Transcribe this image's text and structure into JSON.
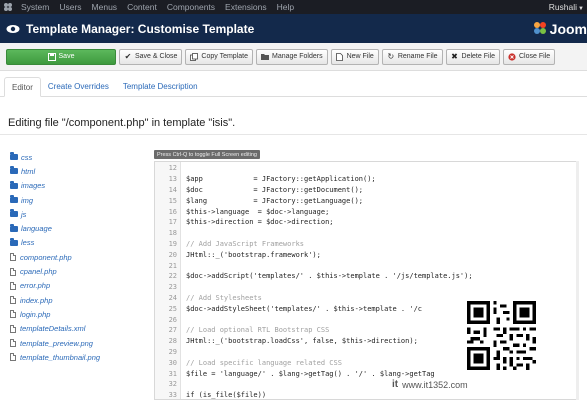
{
  "menubar": {
    "items": [
      "System",
      "Users",
      "Menus",
      "Content",
      "Components",
      "Extensions",
      "Help"
    ],
    "user": "Rushali"
  },
  "titlebar": {
    "title": "Template Manager: Customise Template",
    "brand": "Joom"
  },
  "toolbar": {
    "save": "Save",
    "save_close": "Save & Close",
    "copy_template": "Copy Template",
    "manage_folders": "Manage Folders",
    "new_file": "New File",
    "rename_file": "Rename File",
    "delete_file": "Delete File",
    "close_file": "Close File"
  },
  "tabs": [
    "Editor",
    "Create Overrides",
    "Template Description"
  ],
  "heading": "Editing file \"/component.php\" in template \"isis\".",
  "file_tree": {
    "folders": [
      "css",
      "html",
      "images",
      "img",
      "js",
      "language",
      "less"
    ],
    "files": [
      "component.php",
      "cpanel.php",
      "error.php",
      "index.php",
      "login.php",
      "templateDetails.xml",
      "template_preview.png",
      "template_thumbnail.png"
    ]
  },
  "editor": {
    "hint": "Press Ctrl-Q to toggle Full Screen editing",
    "lines": [
      {
        "n": "12",
        "code": ""
      },
      {
        "n": "13",
        "code": "$app            = JFactory::getApplication();"
      },
      {
        "n": "14",
        "code": "$doc            = JFactory::getDocument();"
      },
      {
        "n": "15",
        "code": "$lang           = JFactory::getLanguage();"
      },
      {
        "n": "16",
        "code": "$this->language  = $doc->language;"
      },
      {
        "n": "17",
        "code": "$this->direction = $doc->direction;"
      },
      {
        "n": "18",
        "code": ""
      },
      {
        "n": "19",
        "code": "// Add JavaScript Frameworks"
      },
      {
        "n": "20",
        "code": "JHtml::_('bootstrap.framework');"
      },
      {
        "n": "21",
        "code": ""
      },
      {
        "n": "22",
        "code": "$doc->addScript('templates/' . $this->template . '/js/template.js');"
      },
      {
        "n": "23",
        "code": ""
      },
      {
        "n": "24",
        "code": "// Add Stylesheets"
      },
      {
        "n": "25",
        "code": "$doc->addStyleSheet('templates/' . $this->template . '/c"
      },
      {
        "n": "26",
        "code": ""
      },
      {
        "n": "27",
        "code": "// Load optional RTL Bootstrap CSS"
      },
      {
        "n": "28",
        "code": "JHtml::_('bootstrap.loadCss', false, $this->direction);"
      },
      {
        "n": "29",
        "code": ""
      },
      {
        "n": "30",
        "code": "// Load specific language related CSS"
      },
      {
        "n": "31",
        "code": "$file = 'language/' . $lang->getTag() . '/' . $lang->getTag"
      },
      {
        "n": "32",
        "code": ""
      },
      {
        "n": "33",
        "code": "if (is_file($file))"
      }
    ]
  },
  "watermark": {
    "brand": "it",
    "site": "www.it1352.com"
  },
  "colors": {
    "menubar": "#1b1d24",
    "titlebar": "#13294b",
    "save_button": "#46a546",
    "link": "#2a69b8"
  }
}
